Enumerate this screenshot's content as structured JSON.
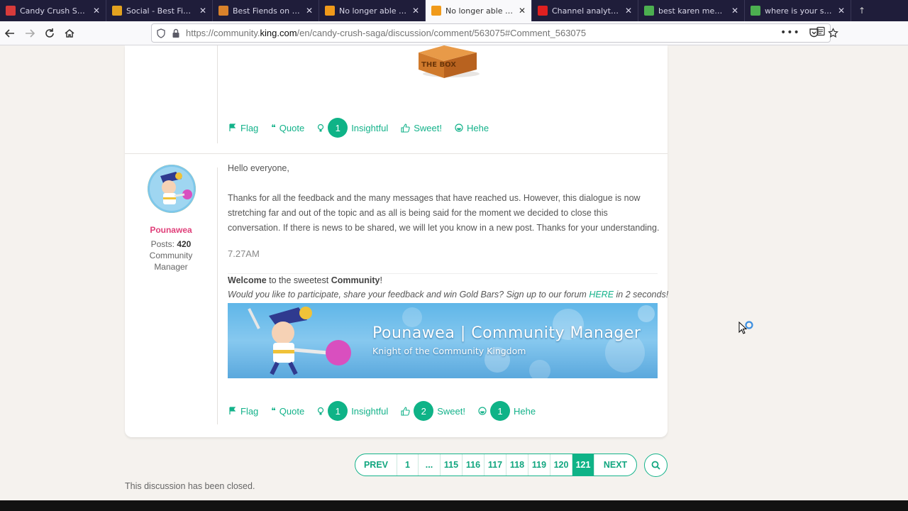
{
  "browser": {
    "tabs": [
      {
        "title": "Candy Crush Saga on",
        "favicon_color": "#d83b3b",
        "active": false
      },
      {
        "title": "Social - Best Fiends",
        "favicon_color": "#e3a21f",
        "active": false
      },
      {
        "title": "Best Fiends on Faceb",
        "favicon_color": "#d9822b",
        "active": false
      },
      {
        "title": "No longer able to ext",
        "favicon_color": "#f09a1a",
        "active": false
      },
      {
        "title": "No longer able to ent",
        "favicon_color": "#f09a1a",
        "active": true
      },
      {
        "title": "Channel analytics -",
        "favicon_color": "#e02020",
        "active": false
      },
      {
        "title": "best karen memes -",
        "favicon_color": "#4caf50",
        "active": false
      },
      {
        "title": "where is your stupid",
        "favicon_color": "#4caf50",
        "active": false
      }
    ],
    "url_prefix": "https://community.",
    "url_domain": "king.com",
    "url_path": "/en/candy-crush-saga/discussion/comment/563075#Comment_563075"
  },
  "first_post": {
    "image_label": "THE BOX",
    "actions": {
      "flag": "Flag",
      "quote": "Quote",
      "insightful": "Insightful",
      "insightful_count": "1",
      "sweet": "Sweet!",
      "hehe": "Hehe"
    }
  },
  "post": {
    "author": "Pounawea",
    "posts_label": "Posts:",
    "posts_count": "420",
    "role_line1": "Community",
    "role_line2": "Manager",
    "greeting": "Hello everyone,",
    "body_line1": "Thanks for all the feedback and the many messages that have reached us. However, this dialogue is now",
    "body_line2": "stretching far and out of the topic and as all is being said for the moment we decided to close this",
    "body_line3": "conversation. If there is news to be shared, we will let you know in a new post. Thanks for your understanding.",
    "time": "7.27AM",
    "sig_welcome_bold": "Welcome",
    "sig_welcome_mid": " to the sweetest ",
    "sig_welcome_bold2": "Community",
    "sig_welcome_end": "!",
    "sig_invite_start": "Would you like to participate, share your feedback and win Gold Bars? Sign up to our forum ",
    "sig_invite_link": "HERE",
    "sig_invite_end": " in 2 seconds!",
    "banner_title": "Pounawea | Community Manager",
    "banner_subtitle": "Knight of the Community Kingdom",
    "actions": {
      "flag": "Flag",
      "quote": "Quote",
      "insightful": "Insightful",
      "insightful_count": "1",
      "sweet": "Sweet!",
      "sweet_count": "2",
      "hehe": "Hehe",
      "hehe_count": "1"
    }
  },
  "pagination": {
    "prev": "PREV",
    "pages": [
      "1",
      "...",
      "115",
      "116",
      "117",
      "118",
      "119",
      "120",
      "121"
    ],
    "current": "121",
    "next": "NEXT"
  },
  "closed_note": "This discussion has been closed.",
  "colors": {
    "accent": "#0fb387",
    "author": "#e0407a"
  }
}
